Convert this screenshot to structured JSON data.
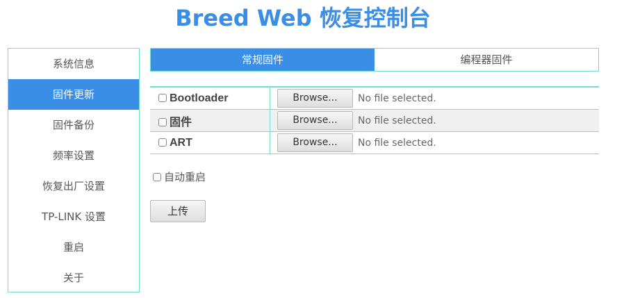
{
  "header": {
    "title": "Breed Web 恢复控制台"
  },
  "sidebar": {
    "items": [
      {
        "label": "系统信息",
        "active": false
      },
      {
        "label": "固件更新",
        "active": true
      },
      {
        "label": "固件备份",
        "active": false
      },
      {
        "label": "频率设置",
        "active": false
      },
      {
        "label": "恢复出厂设置",
        "active": false
      },
      {
        "label": "TP-LINK 设置",
        "active": false
      },
      {
        "label": "重启",
        "active": false
      },
      {
        "label": "关于",
        "active": false
      }
    ]
  },
  "tabs": [
    {
      "label": "常规固件",
      "active": true
    },
    {
      "label": "编程器固件",
      "active": false
    }
  ],
  "firmware_files": [
    {
      "label": "Bootloader",
      "checked": false,
      "browse_label": "Browse...",
      "status": "No file selected."
    },
    {
      "label": "固件",
      "checked": false,
      "browse_label": "Browse...",
      "status": "No file selected."
    },
    {
      "label": "ART",
      "checked": false,
      "browse_label": "Browse...",
      "status": "No file selected."
    }
  ],
  "auto_reboot": {
    "label": "自动重启",
    "checked": false
  },
  "upload_button": {
    "label": "上传"
  },
  "colors": {
    "accent": "#3a8ee6",
    "border": "#6fe0cf",
    "row_alt": "#f0f0f0"
  }
}
